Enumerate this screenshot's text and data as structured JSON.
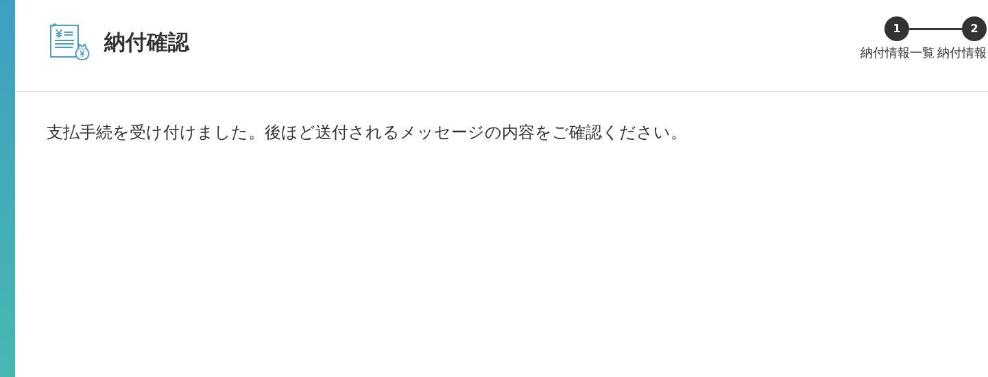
{
  "header": {
    "title": "納付確認"
  },
  "steps": [
    {
      "number": "1",
      "label": "納付情報一覧"
    },
    {
      "number": "2",
      "label": "納付情報"
    }
  ],
  "message": "支払手続を受け付けました。後ほど送付されるメッセージの内容をご確認ください。"
}
